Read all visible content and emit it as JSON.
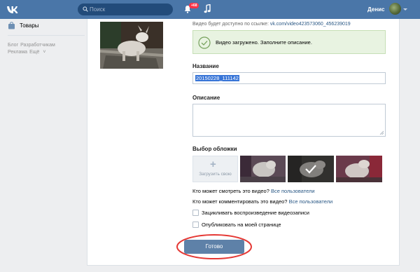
{
  "header": {
    "search_placeholder": "Поиск",
    "notifications_count": "+68",
    "user_name": "Денис",
    "brand_color": "#4a76a8"
  },
  "sidebar": {
    "items": [
      {
        "label": "Товары",
        "icon": "bag-icon"
      }
    ],
    "footer_links": [
      "Блог",
      "Разработчикам",
      "Реклама",
      "Ещё"
    ]
  },
  "upload": {
    "availability_text": "Видео будет доступно по ссылке:",
    "video_link": "vk.com/video423573060_456239019",
    "success_message": "Видео загружено. Заполните описание.",
    "title_label": "Название",
    "title_value": "20150228_111142",
    "description_label": "Описание",
    "description_value": "",
    "cover_label": "Выбор обложки",
    "upload_cover_label": "Загрузить свою",
    "view_question": "Кто может смотреть это видео?",
    "view_value": "Все пользователи",
    "comment_question": "Кто может комментировать это видео?",
    "comment_value": "Все пользователи",
    "loop_label": "Зацикливать воспроизведение видеозаписи",
    "publish_label": "Опубликовать на моей странице",
    "done_label": "Готово",
    "success_color": "#e8f3e1",
    "highlight_color": "#e53935"
  }
}
